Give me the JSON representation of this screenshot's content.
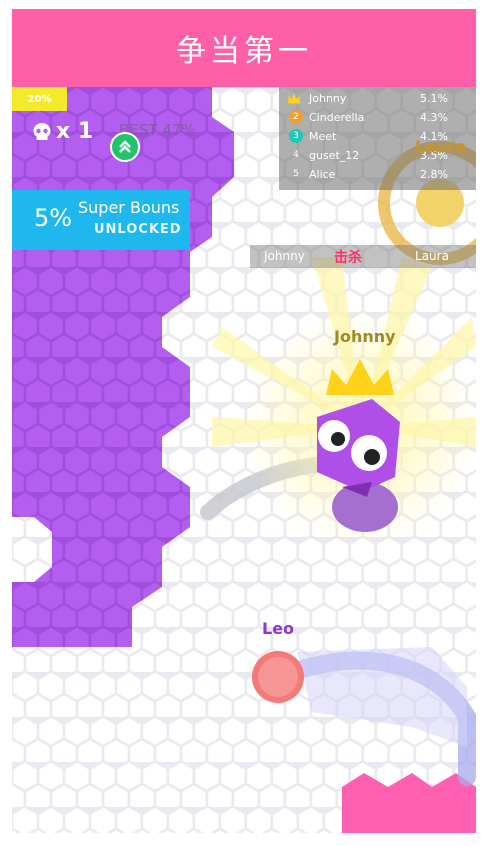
{
  "banner": {
    "title": "争当第一"
  },
  "hud": {
    "progress_label": "20%",
    "progress_value": 0.2,
    "lives_label": "x 1",
    "best_label": "BEST 47%"
  },
  "bonus": {
    "percent": "5%",
    "title": "Super  Bouns",
    "status": "UNLOCKED"
  },
  "leaderboard": [
    {
      "rank": "",
      "name": "Johnny",
      "percent": "5.1%",
      "icon": "crown-icon"
    },
    {
      "rank": "2",
      "name": "Cinderella",
      "percent": "4.3%",
      "color": "#f0a030"
    },
    {
      "rank": "3",
      "name": "Meet",
      "percent": "4.1%",
      "color": "#21c6b5"
    },
    {
      "rank": "4",
      "name": "guset_12",
      "percent": "3.5%"
    },
    {
      "rank": "5",
      "name": "Alice",
      "percent": "2.8%"
    }
  ],
  "kill_feed": {
    "killer": "Johnny",
    "action": "击杀",
    "victim": "Laura"
  },
  "players": {
    "laura": {
      "name": "Laura",
      "color": "#e8b84a"
    },
    "johnny": {
      "name": "Johnny",
      "color": "#b04ee8"
    },
    "leo": {
      "name": "Leo",
      "color": "#f47a7a"
    }
  },
  "colors": {
    "banner": "#ff5fa6",
    "purple_territory": "#b35ef0",
    "pink_territory": "#ff5fb0",
    "bonus": "#1fb8ee"
  }
}
